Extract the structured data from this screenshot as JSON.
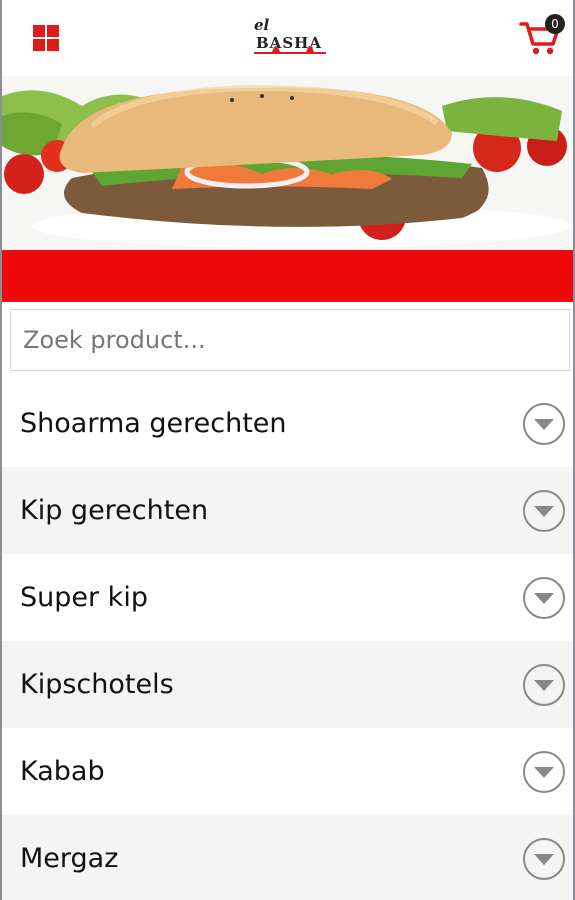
{
  "header": {
    "logo_text_top": "el",
    "logo_text_main": "BASHA",
    "cart_count": "0"
  },
  "search": {
    "placeholder": "Zoek product...",
    "value": ""
  },
  "categories": [
    {
      "label": "Shoarma gerechten"
    },
    {
      "label": "Kip gerechten"
    },
    {
      "label": "Super kip"
    },
    {
      "label": "Kipschotels"
    },
    {
      "label": "Kabab"
    },
    {
      "label": "Mergaz"
    }
  ],
  "colors": {
    "accent": "#ee0a0a",
    "icon_red": "#e01b1b",
    "stripe": "#f4f4f4"
  },
  "icons": {
    "menu": "grid-icon",
    "cart": "cart-icon",
    "category_toggle": "chevron-down-circle-icon"
  }
}
